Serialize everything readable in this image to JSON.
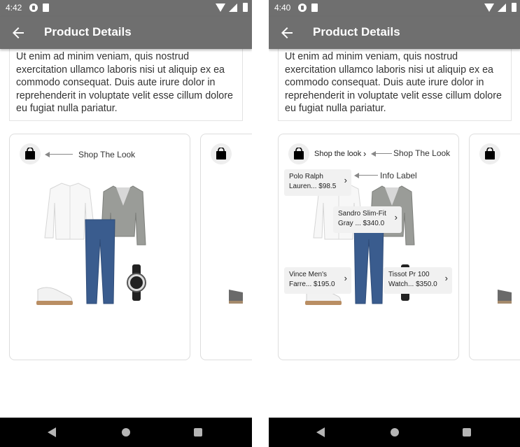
{
  "left": {
    "status_time": "4:42",
    "title": "Product Details",
    "description": "Ut enim ad minim veniam, quis nostrud exercitation ullamco laboris nisi ut aliquip ex ea commodo consequat. Duis aute irure dolor in reprehenderit in voluptate velit esse cillum dolore eu fugiat nulla pariatur.",
    "annotation": "Shop The Look"
  },
  "right": {
    "status_time": "4:40",
    "title": "Product Details",
    "description": "Ut enim ad minim veniam, quis nostrud exercitation ullamco laboris nisi ut aliquip ex ea commodo consequat. Duis aute irure dolor in reprehenderit in voluptate velit esse cillum dolore eu fugiat nulla pariatur.",
    "shop_inline": "Shop the look",
    "annotation_shop": "Shop The Look",
    "annotation_info": "Info Label",
    "labels": [
      {
        "title": "Polo Ralph",
        "price": "Lauren... $98.5"
      },
      {
        "title": "Sandro Slim-Fit",
        "price": "Gray ... $340.0"
      },
      {
        "title": "Vince Men's",
        "price": "Farre... $195.0"
      },
      {
        "title": "Tissot Pr 100",
        "price": "Watch... $350.0"
      }
    ]
  },
  "colors": {
    "appbar": "#6f6f6f",
    "shirt": "#f7f7f7",
    "jeans": "#3a5c8e",
    "blazer": "#9a9c98"
  },
  "icons": [
    "back-arrow-icon",
    "shopping-bag-icon",
    "chevron-right-icon",
    "nav-back-icon",
    "nav-home-icon",
    "nav-recents-icon"
  ]
}
